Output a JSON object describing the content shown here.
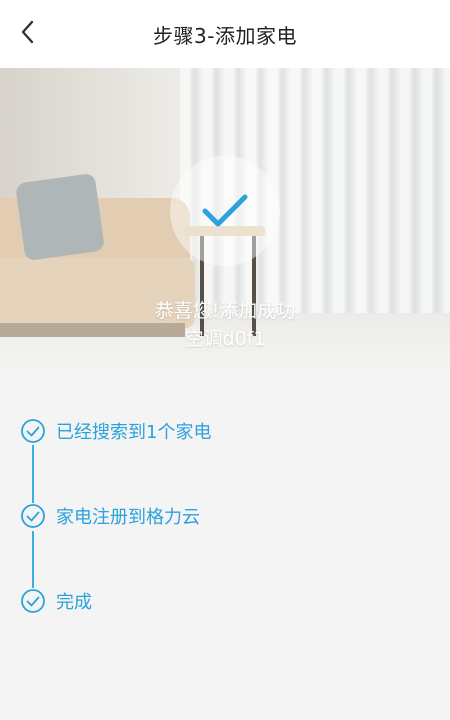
{
  "header": {
    "title": "步骤3-添加家电",
    "back_icon": "chevron-left-icon"
  },
  "hero": {
    "status_icon": "checkmark-icon",
    "message": "恭喜您!添加成功",
    "device_name": "空调d0f1"
  },
  "steps": [
    {
      "label": "已经搜索到1个家电",
      "icon": "check-circle-icon"
    },
    {
      "label": "家电注册到格力云",
      "icon": "check-circle-icon"
    },
    {
      "label": "完成",
      "icon": "check-circle-icon"
    }
  ],
  "colors": {
    "accent": "#2aa2dc",
    "header_bg": "#ffffff",
    "page_bg": "#f4f4f4"
  }
}
